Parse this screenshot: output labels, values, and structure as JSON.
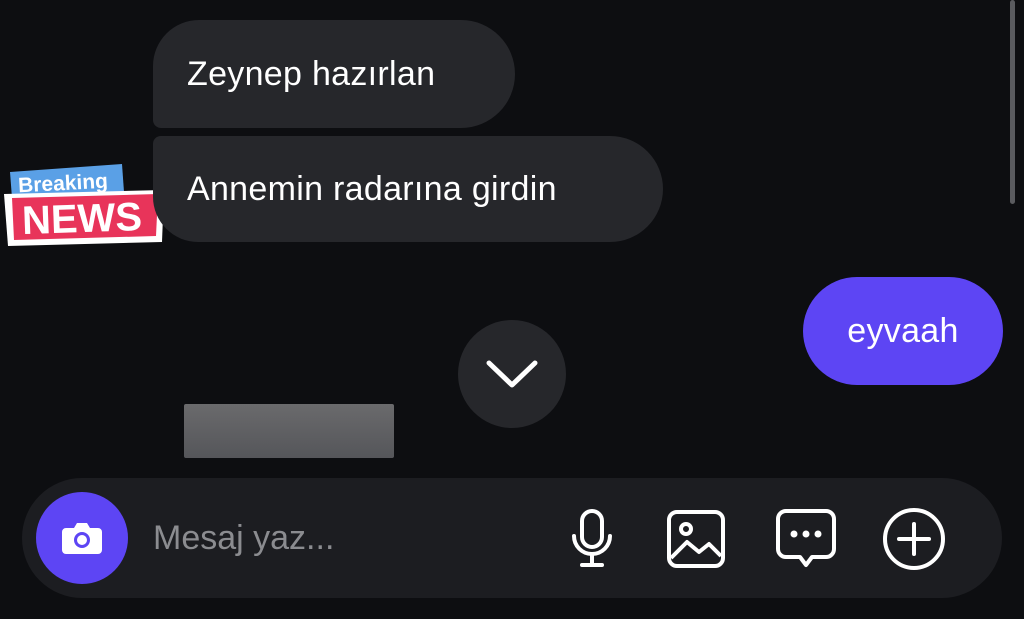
{
  "messages": [
    {
      "text": "Zeynep hazırlan",
      "side": "received"
    },
    {
      "text": "Annemin radarına girdin",
      "side": "received"
    },
    {
      "text": "eyvaah",
      "side": "sent"
    }
  ],
  "sticker": {
    "line1": "Breaking",
    "line2": "NEWS"
  },
  "composer": {
    "placeholder": "Mesaj yaz...",
    "icons": [
      "camera-icon",
      "microphone-icon",
      "image-icon",
      "sticker-icon",
      "plus-icon"
    ]
  },
  "colors": {
    "accent": "#5d45f4",
    "received_bubble": "#26272b",
    "background": "#0d0e11",
    "sticker_blue": "#5aa0e6",
    "sticker_red": "#e8345a"
  }
}
